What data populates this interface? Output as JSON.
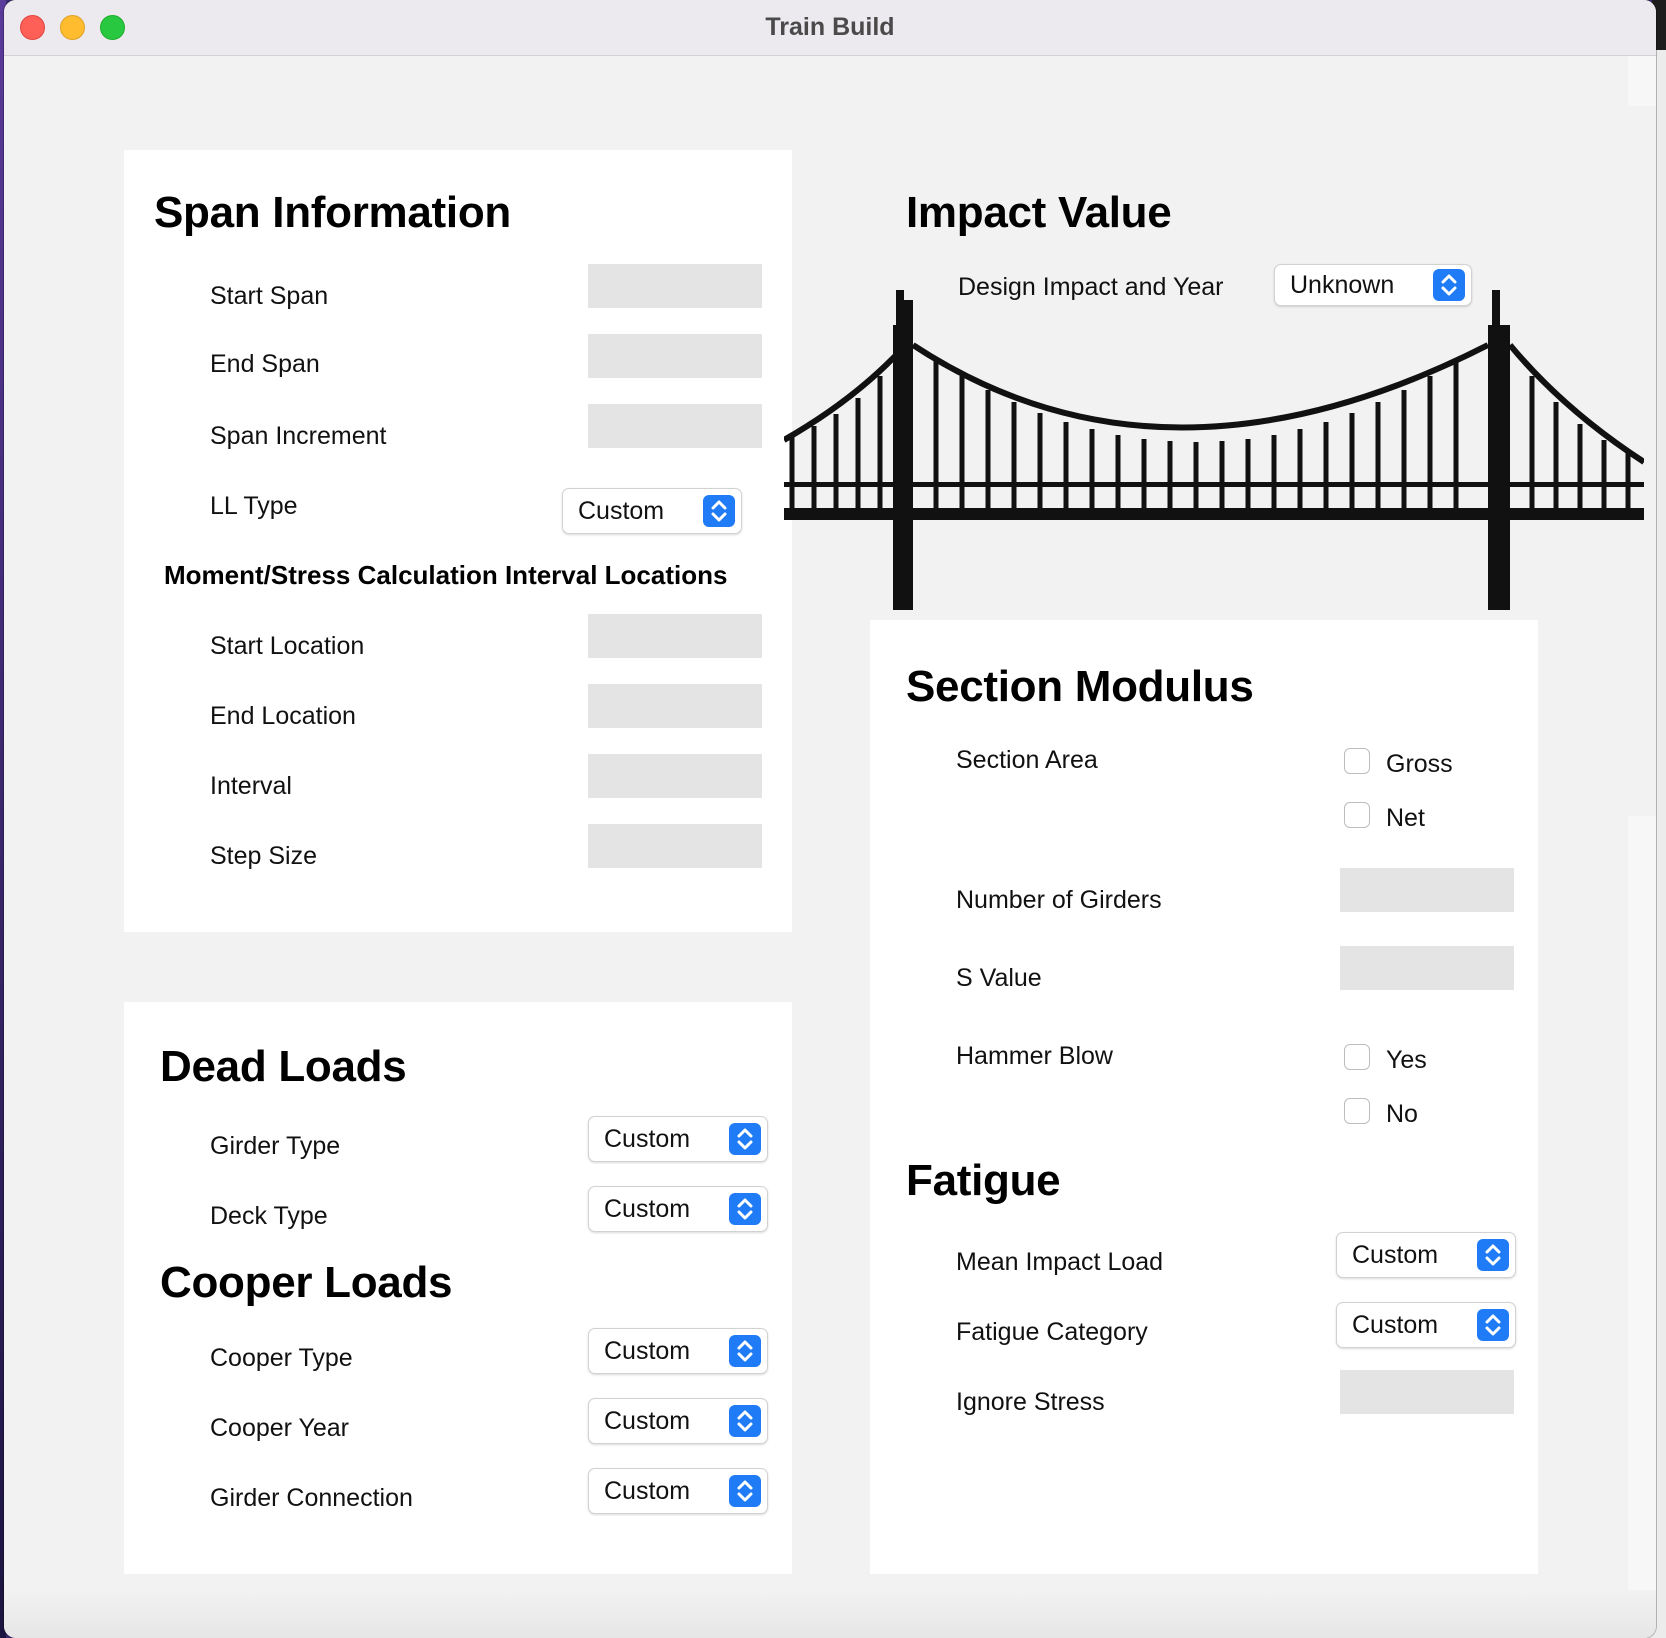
{
  "window": {
    "title": "Train Build"
  },
  "span_info": {
    "title": "Span Information",
    "start_span": "Start Span",
    "end_span": "End Span",
    "span_increment": "Span Increment",
    "ll_type": {
      "label": "LL Type",
      "value": "Custom"
    },
    "subtitle": "Moment/Stress Calculation Interval Locations",
    "start_location": "Start Location",
    "end_location": "End Location",
    "interval": "Interval",
    "step_size": "Step Size"
  },
  "dead_loads": {
    "title": "Dead Loads",
    "girder_type": {
      "label": "Girder Type",
      "value": "Custom"
    },
    "deck_type": {
      "label": "Deck Type",
      "value": "Custom"
    }
  },
  "cooper_loads": {
    "title": "Cooper Loads",
    "cooper_type": {
      "label": "Cooper Type",
      "value": "Custom"
    },
    "cooper_year": {
      "label": "Cooper Year",
      "value": "Custom"
    },
    "girder_connection": {
      "label": "Girder Connection",
      "value": "Custom"
    }
  },
  "impact": {
    "title": "Impact Value",
    "design_impact": {
      "label": "Design Impact and Year",
      "value": "Unknown"
    }
  },
  "section_modulus": {
    "title": "Section Modulus",
    "section_area": "Section Area",
    "gross": "Gross",
    "net": "Net",
    "number_of_girders": "Number of Girders",
    "s_value": "S Value",
    "hammer_blow": "Hammer Blow",
    "yes": "Yes",
    "no": "No"
  },
  "fatigue": {
    "title": "Fatigue",
    "mean_impact_load": {
      "label": "Mean Impact Load",
      "value": "Custom"
    },
    "fatigue_category": {
      "label": "Fatigue Category",
      "value": "Custom"
    },
    "ignore_stress": "Ignore Stress"
  },
  "colors": {
    "accent": "#1f7bf6",
    "field_bg": "#e4e4e4",
    "window_bg": "#f2f2f2"
  }
}
